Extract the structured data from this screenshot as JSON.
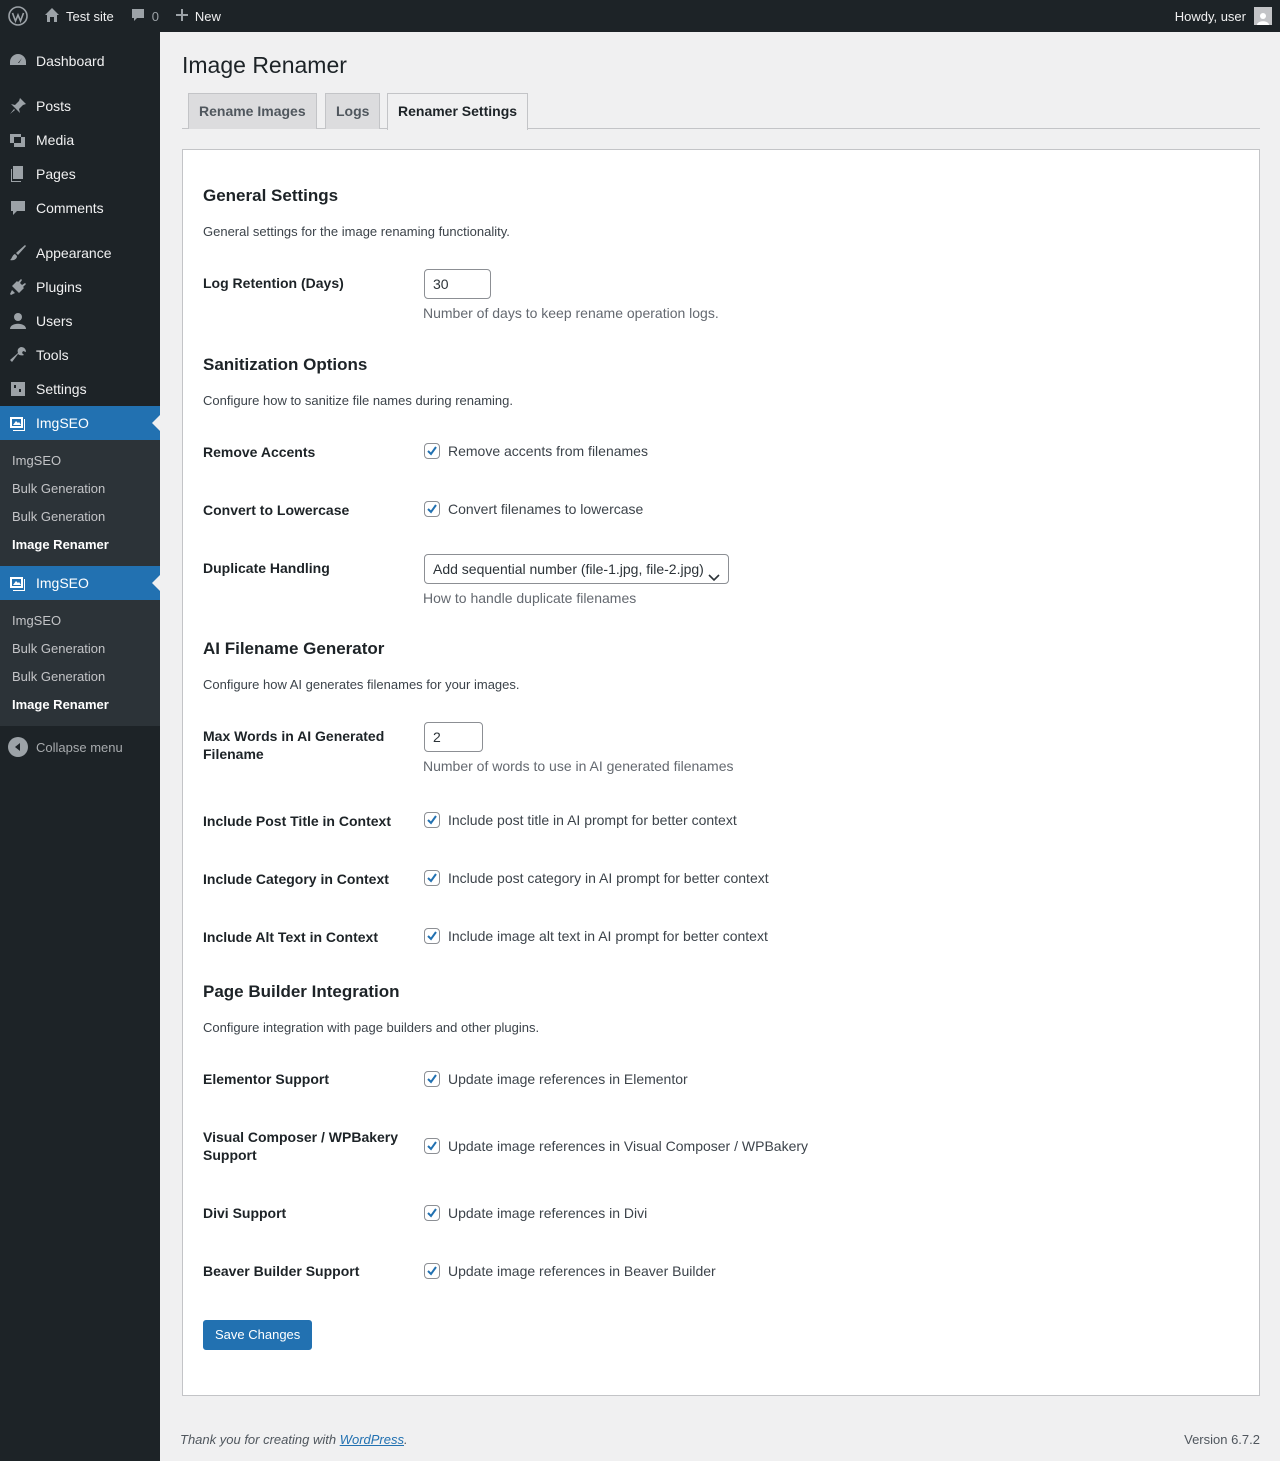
{
  "adminbar": {
    "site_name": "Test site",
    "comments_count": "0",
    "new_label": "New",
    "howdy": "Howdy, user"
  },
  "sidebar": {
    "items": [
      {
        "label": "Dashboard",
        "icon": "dashboard-icon"
      },
      {
        "label": "Posts",
        "icon": "pin-icon"
      },
      {
        "label": "Media",
        "icon": "media-icon"
      },
      {
        "label": "Pages",
        "icon": "pages-icon"
      },
      {
        "label": "Comments",
        "icon": "comment-icon"
      },
      {
        "label": "Appearance",
        "icon": "brush-icon"
      },
      {
        "label": "Plugins",
        "icon": "plug-icon"
      },
      {
        "label": "Users",
        "icon": "user-icon"
      },
      {
        "label": "Tools",
        "icon": "wrench-icon"
      },
      {
        "label": "Settings",
        "icon": "settings-icon"
      }
    ],
    "imgseo_groups": [
      {
        "label": "ImgSEO",
        "sub": [
          "ImgSEO",
          "Bulk Generation",
          "Bulk Generation",
          "Image Renamer"
        ]
      },
      {
        "label": "ImgSEO",
        "sub": [
          "ImgSEO",
          "Bulk Generation",
          "Bulk Generation",
          "Image Renamer"
        ]
      }
    ],
    "collapse_label": "Collapse menu"
  },
  "page": {
    "title": "Image Renamer",
    "tabs": [
      "Rename Images",
      "Logs",
      "Renamer Settings"
    ],
    "active_tab": "Renamer Settings"
  },
  "sections": {
    "general": {
      "title": "General Settings",
      "desc": "General settings for the image renaming functionality.",
      "log_retention_label": "Log Retention (Days)",
      "log_retention_value": "30",
      "log_retention_desc": "Number of days to keep rename operation logs."
    },
    "sanitization": {
      "title": "Sanitization Options",
      "desc": "Configure how to sanitize file names during renaming.",
      "remove_accents_label": "Remove Accents",
      "remove_accents_text": "Remove accents from filenames",
      "lowercase_label": "Convert to Lowercase",
      "lowercase_text": "Convert filenames to lowercase",
      "duplicate_label": "Duplicate Handling",
      "duplicate_value": "Add sequential number (file-1.jpg, file-2.jpg)",
      "duplicate_desc": "How to handle duplicate filenames"
    },
    "ai": {
      "title": "AI Filename Generator",
      "desc": "Configure how AI generates filenames for your images.",
      "max_words_label": "Max Words in AI Generated Filename",
      "max_words_value": "2",
      "max_words_desc": "Number of words to use in AI generated filenames",
      "post_title_label": "Include Post Title in Context",
      "post_title_text": "Include post title in AI prompt for better context",
      "category_label": "Include Category in Context",
      "category_text": "Include post category in AI prompt for better context",
      "alt_label": "Include Alt Text in Context",
      "alt_text": "Include image alt text in AI prompt for better context"
    },
    "builder": {
      "title": "Page Builder Integration",
      "desc": "Configure integration with page builders and other plugins.",
      "elementor_label": "Elementor Support",
      "elementor_text": "Update image references in Elementor",
      "vc_label": "Visual Composer / WPBakery Support",
      "vc_text": "Update image references in Visual Composer / WPBakery",
      "divi_label": "Divi Support",
      "divi_text": "Update image references in Divi",
      "beaver_label": "Beaver Builder Support",
      "beaver_text": "Update image references in Beaver Builder"
    }
  },
  "save_label": "Save Changes",
  "footer": {
    "thanks_prefix": "Thank you for creating with ",
    "thanks_link": "WordPress",
    "thanks_suffix": ".",
    "version": "Version 6.7.2"
  },
  "colors": {
    "admin_dark": "#1d2327",
    "accent": "#2271b1",
    "background": "#f0f0f1"
  }
}
